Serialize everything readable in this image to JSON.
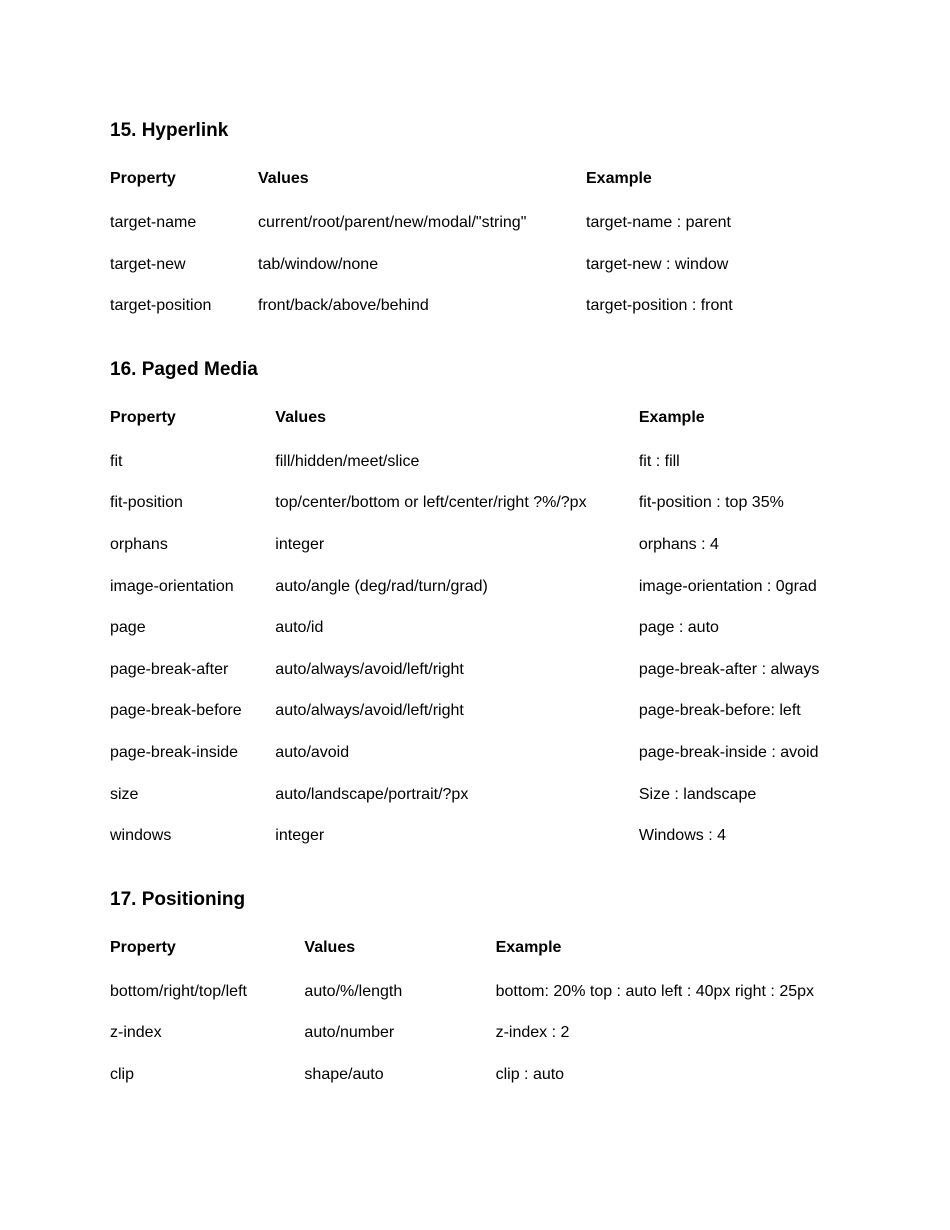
{
  "sections": [
    {
      "title": "15. Hyperlink",
      "headers": {
        "property": "Property",
        "values": "Values",
        "example": "Example"
      },
      "rows": [
        {
          "property": "target-name",
          "values": "current/root/parent/new/modal/\"string\"",
          "example": "target-name : parent"
        },
        {
          "property": "target-new",
          "values": "tab/window/none",
          "example": "target-new : window"
        },
        {
          "property": "target-position",
          "values": "front/back/above/behind",
          "example": "target-position : front"
        }
      ]
    },
    {
      "title": "16. Paged Media",
      "headers": {
        "property": "Property",
        "values": "Values",
        "example": "Example"
      },
      "rows": [
        {
          "property": "fit",
          "values": "fill/hidden/meet/slice",
          "example": "fit : fill"
        },
        {
          "property": "fit-position",
          "values": "top/center/bottom or left/center/right ?%/?px",
          "example": "fit-position : top 35%"
        },
        {
          "property": "orphans",
          "values": "integer",
          "example": "orphans : 4"
        },
        {
          "property": "image-orientation",
          "values": "auto/angle (deg/rad/turn/grad)",
          "example": "image-orientation : 0grad"
        },
        {
          "property": "page",
          "values": "auto/id",
          "example": "page : auto"
        },
        {
          "property": "page-break-after",
          "values": "auto/always/avoid/left/right",
          "example": "page-break-after : always"
        },
        {
          "property": "page-break-before",
          "values": "auto/always/avoid/left/right",
          "example": "page-break-before: left"
        },
        {
          "property": "page-break-inside",
          "values": "auto/avoid",
          "example": "page-break-inside : avoid"
        },
        {
          "property": "size",
          "values": "auto/landscape/portrait/?px",
          "example": "Size : landscape"
        },
        {
          "property": "windows",
          "values": "integer",
          "example": "Windows : 4"
        }
      ]
    },
    {
      "title": "17. Positioning",
      "headers": {
        "property": "Property",
        "values": "Values",
        "example": "Example"
      },
      "rows": [
        {
          "property": "bottom/right/top/left",
          "values": "auto/%/length",
          "example": "bottom: 20% top : auto left : 40px right : 25px"
        },
        {
          "property": "z-index",
          "values": "auto/number",
          "example": "z-index : 2"
        },
        {
          "property": "clip",
          "values": "shape/auto",
          "example": "clip : auto"
        }
      ]
    }
  ]
}
